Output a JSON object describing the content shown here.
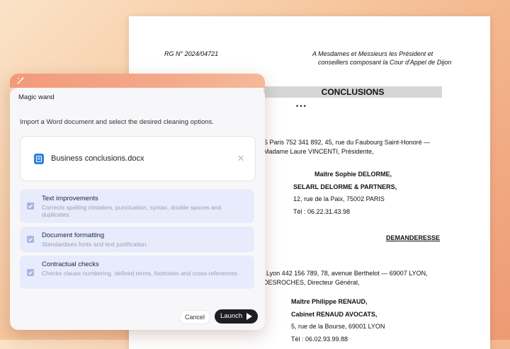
{
  "document": {
    "case_ref": "RG N° 2024/04721",
    "addressee_line1": "A Mesdames et Messieurs les Président et",
    "addressee_line2": "conseillers composant la Cour d'Appel de Dijon",
    "heading": "CONCLUSIONS",
    "stars": "* * *",
    "line_rcs": "S Paris 752 341 892, 45, rue du Faubourg Saint-Honoré —",
    "line_president": "Madame Laure VINCENTI, Présidente,",
    "lawyer1_name": "Maître Sophie DELORME,",
    "lawyer1_firm": "SELARL DELORME & PARTNERS,",
    "lawyer1_address": "12, rue de la Paix, 75002 PARIS",
    "lawyer1_tel": "Tèl : 06.22.31.43.98",
    "role_claimant": "DEMANDERESSE",
    "line_lyon": "Lyon 442 156 789, 78, avenue Berthelot — 69007 LYON,",
    "line_director": "DESROCHES, Directeur Général,",
    "lawyer2_name": "Maître Philippe RENAUD,",
    "lawyer2_firm": "Cabinet RENAUD AVOCATS,",
    "lawyer2_address": "5, rue de la Bourse, 69001 LYON",
    "lawyer2_tel": "Tèl : 06.02.93.99.88"
  },
  "panel": {
    "title": "Magic wand",
    "description": "Import a Word document and select the desired cleaning options.",
    "file_name": "Business conclusions.docx",
    "options": [
      {
        "label": "Text improvements",
        "sub": "Corrects spelling mistakes, punctuation, syntax, double spaces and duplicates.",
        "checked": true
      },
      {
        "label": "Document formatting",
        "sub": "Standardises fonts and text justification.",
        "checked": true
      },
      {
        "label": "Contractual checks",
        "sub": "Checks clause numbering, defined terms, footnotes and cross-references.",
        "checked": true
      }
    ],
    "cancel_label": "Cancel",
    "launch_label": "Launch"
  },
  "colors": {
    "accent_option_bg": "#e7ebfc",
    "checkbox": "#a8b4e6",
    "file_icon": "#2b7fe0",
    "launch_button": "#1e1e22"
  },
  "icons": [
    "magic-wand-icon",
    "word-file-icon",
    "close-icon",
    "checkbox-checked-icon",
    "play-icon"
  ]
}
